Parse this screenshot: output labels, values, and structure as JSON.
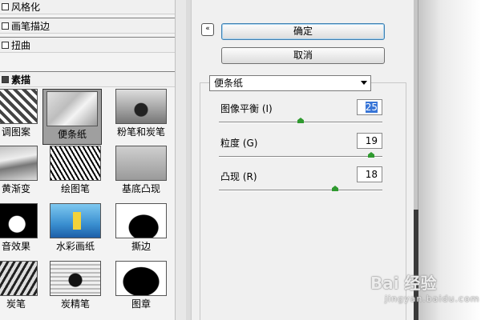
{
  "categories": [
    {
      "label": "风格化",
      "open": false
    },
    {
      "label": "画笔描边",
      "open": false
    },
    {
      "label": "扭曲",
      "open": false
    },
    {
      "label": "素描",
      "open": true
    }
  ],
  "thumbnails": [
    {
      "label": "调图案",
      "selected": false
    },
    {
      "label": "便条纸",
      "selected": true
    },
    {
      "label": "粉笔和炭笔",
      "selected": false
    },
    {
      "label": "黄渐变",
      "selected": false
    },
    {
      "label": "绘图笔",
      "selected": false
    },
    {
      "label": "基底凸现",
      "selected": false
    },
    {
      "label": "音效果",
      "selected": false
    },
    {
      "label": "水彩画纸",
      "selected": false
    },
    {
      "label": "撕边",
      "selected": false
    },
    {
      "label": "炭笔",
      "selected": false
    },
    {
      "label": "炭精笔",
      "selected": false
    },
    {
      "label": "图章",
      "selected": false
    }
  ],
  "buttons": {
    "collapse": "«",
    "ok": "确定",
    "cancel": "取消"
  },
  "filter_select": {
    "value": "便条纸"
  },
  "params": [
    {
      "label": "图像平衡 (I)",
      "value": "25",
      "level": 0.5
    },
    {
      "label": "粒度 (G)",
      "value": "19",
      "level": 0.95
    },
    {
      "label": "凸现 (R)",
      "value": "18",
      "level": 0.72
    }
  ],
  "watermark": {
    "text": "Bai 经验",
    "sub": "jingyan.baidu.com"
  },
  "colors": {
    "accent": "#3875d7",
    "slider_knob": "#2f9a2f",
    "ok_border": "#3c7fb1"
  }
}
